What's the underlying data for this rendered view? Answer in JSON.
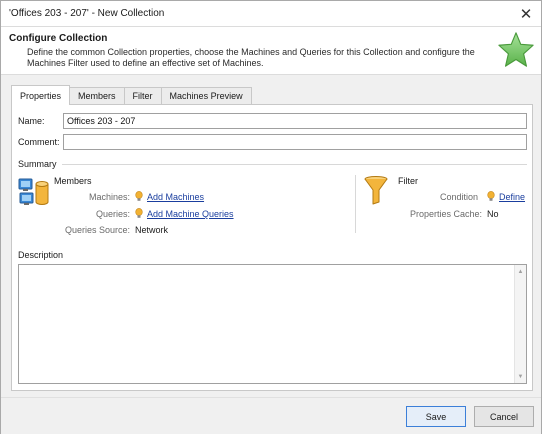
{
  "window": {
    "title": "'Offices 203 - 207' - New Collection",
    "close_icon": "close-icon"
  },
  "header": {
    "title": "Configure Collection",
    "description": "Define the common Collection properties, choose the Machines and Queries for this Collection and configure the Machines Filter used to define an effective set of Machines.",
    "icon": "star-icon",
    "icon_color": "#7fcf6e"
  },
  "tabs": [
    {
      "label": "Properties",
      "active": true
    },
    {
      "label": "Members",
      "active": false
    },
    {
      "label": "Filter",
      "active": false
    },
    {
      "label": "Machines Preview",
      "active": false
    }
  ],
  "properties": {
    "name_label": "Name:",
    "name_value": "Offices 203 - 207",
    "comment_label": "Comment:",
    "comment_value": ""
  },
  "summary": {
    "heading": "Summary",
    "members": {
      "heading": "Members",
      "icon": "computers-database-icon",
      "machines_label": "Machines:",
      "machines_link": "Add Machines",
      "queries_label": "Queries:",
      "queries_link": "Add Machine Queries",
      "queries_source_label": "Queries Source:",
      "queries_source_value": "Network"
    },
    "filter": {
      "heading": "Filter",
      "icon": "funnel-icon",
      "condition_label": "Condition",
      "condition_link": "Define",
      "cache_label": "Properties Cache:",
      "cache_value": "No"
    }
  },
  "description": {
    "label": "Description",
    "value": ""
  },
  "footer": {
    "save_label": "Save",
    "cancel_label": "Cancel"
  },
  "colors": {
    "link": "#1a3e9e",
    "bulb": "#f2b233",
    "accent": "#3c7fd8"
  }
}
